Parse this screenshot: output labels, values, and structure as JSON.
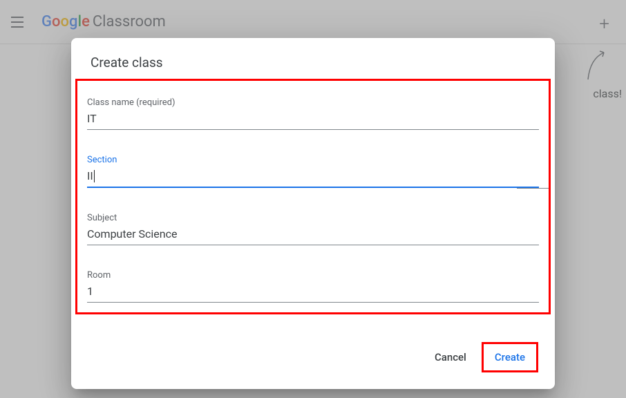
{
  "header": {
    "logo_prefix": "Google",
    "logo_suffix": "Classroom"
  },
  "background": {
    "hint_text": "class!"
  },
  "dialog": {
    "title": "Create class",
    "fields": {
      "class_name": {
        "label": "Class name (required)",
        "value": "IT"
      },
      "section": {
        "label": "Section",
        "value": "II"
      },
      "subject": {
        "label": "Subject",
        "value": "Computer Science"
      },
      "room": {
        "label": "Room",
        "value": "1"
      }
    },
    "actions": {
      "cancel": "Cancel",
      "create": "Create"
    }
  }
}
